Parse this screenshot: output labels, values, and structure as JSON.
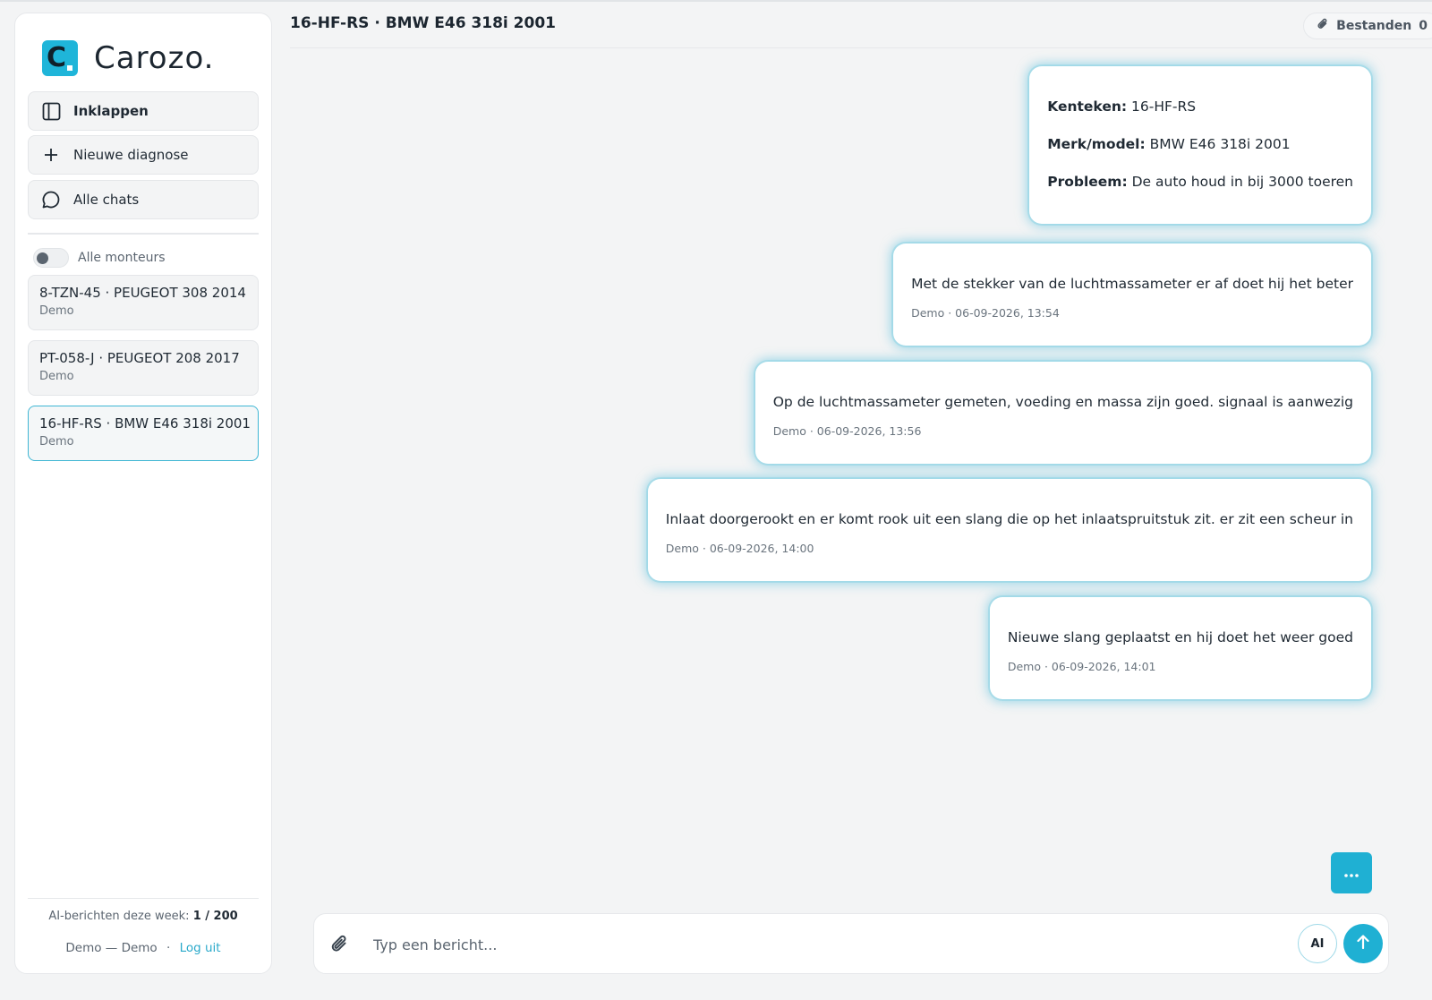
{
  "brand": {
    "name": "Carozo.",
    "logo_letter": "C"
  },
  "sidebar": {
    "nav": [
      {
        "label": "Inklappen",
        "icon": "sidebar-panel-icon"
      },
      {
        "label": "Nieuwe diagnose",
        "icon": "plus-icon"
      },
      {
        "label": "Alle chats",
        "icon": "chat-bubble-icon"
      }
    ],
    "toggle_label": "Alle monteurs",
    "toggle_on": false,
    "chats": [
      {
        "title": "8-TZN-45 · PEUGEOT 308 2014",
        "subtitle": "Demo",
        "active": false
      },
      {
        "title": "PT-058-J · PEUGEOT 208 2017",
        "subtitle": "Demo",
        "active": false
      },
      {
        "title": "16-HF-RS · BMW E46 318i 2001",
        "subtitle": "Demo",
        "active": true
      }
    ],
    "footer": {
      "usage_label": "AI-berichten deze week:",
      "usage_value": "1 / 200",
      "user": "Demo — Demo",
      "separator": "·",
      "logout": "Log uit"
    }
  },
  "header": {
    "title": "16-HF-RS · BMW E46 318i 2001",
    "files_label": "Bestanden",
    "files_count": "0"
  },
  "summary": {
    "rows": [
      {
        "key": "Kenteken:",
        "value": "16-HF-RS"
      },
      {
        "key": "Merk/model:",
        "value": "BMW E46 318i 2001"
      },
      {
        "key": "Probleem:",
        "value": "De auto houd in bij 3000 toeren"
      }
    ]
  },
  "messages": [
    {
      "text": "Met de stekker van de luchtmassameter er af doet hij het beter",
      "meta": "Demo · 06-09-2026, 13:54"
    },
    {
      "text": "Op de luchtmassameter gemeten, voeding en massa zijn goed. signaal is aanwezig",
      "meta": "Demo · 06-09-2026, 13:56"
    },
    {
      "text": "Inlaat doorgerookt en er komt rook uit een slang die op het inlaatspruitstuk zit. er zit een scheur in",
      "meta": "Demo · 06-09-2026, 14:00"
    },
    {
      "text": "Nieuwe slang geplaatst en hij doet het weer goed",
      "meta": "Demo · 06-09-2026, 14:01"
    }
  ],
  "composer": {
    "placeholder": "Typ een bericht...",
    "ai_label": "AI",
    "attach_icon": "paperclip-icon",
    "send_icon": "arrow-up-icon",
    "more_icon": "ellipsis-icon"
  },
  "colors": {
    "accent": "#1fb0d3",
    "glow": "#54beda",
    "background": "#f3f4f5"
  }
}
